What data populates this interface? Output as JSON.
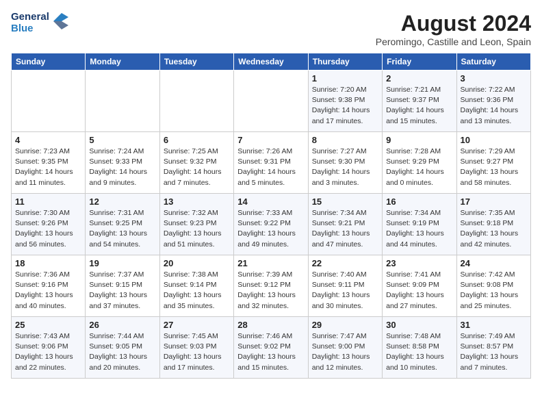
{
  "logo": {
    "line1": "General",
    "line2": "Blue"
  },
  "title": "August 2024",
  "location": "Peromingo, Castille and Leon, Spain",
  "weekdays": [
    "Sunday",
    "Monday",
    "Tuesday",
    "Wednesday",
    "Thursday",
    "Friday",
    "Saturday"
  ],
  "weeks": [
    [
      {
        "day": "",
        "info": ""
      },
      {
        "day": "",
        "info": ""
      },
      {
        "day": "",
        "info": ""
      },
      {
        "day": "",
        "info": ""
      },
      {
        "day": "1",
        "info": "Sunrise: 7:20 AM\nSunset: 9:38 PM\nDaylight: 14 hours and 17 minutes."
      },
      {
        "day": "2",
        "info": "Sunrise: 7:21 AM\nSunset: 9:37 PM\nDaylight: 14 hours and 15 minutes."
      },
      {
        "day": "3",
        "info": "Sunrise: 7:22 AM\nSunset: 9:36 PM\nDaylight: 14 hours and 13 minutes."
      }
    ],
    [
      {
        "day": "4",
        "info": "Sunrise: 7:23 AM\nSunset: 9:35 PM\nDaylight: 14 hours and 11 minutes."
      },
      {
        "day": "5",
        "info": "Sunrise: 7:24 AM\nSunset: 9:33 PM\nDaylight: 14 hours and 9 minutes."
      },
      {
        "day": "6",
        "info": "Sunrise: 7:25 AM\nSunset: 9:32 PM\nDaylight: 14 hours and 7 minutes."
      },
      {
        "day": "7",
        "info": "Sunrise: 7:26 AM\nSunset: 9:31 PM\nDaylight: 14 hours and 5 minutes."
      },
      {
        "day": "8",
        "info": "Sunrise: 7:27 AM\nSunset: 9:30 PM\nDaylight: 14 hours and 3 minutes."
      },
      {
        "day": "9",
        "info": "Sunrise: 7:28 AM\nSunset: 9:29 PM\nDaylight: 14 hours and 0 minutes."
      },
      {
        "day": "10",
        "info": "Sunrise: 7:29 AM\nSunset: 9:27 PM\nDaylight: 13 hours and 58 minutes."
      }
    ],
    [
      {
        "day": "11",
        "info": "Sunrise: 7:30 AM\nSunset: 9:26 PM\nDaylight: 13 hours and 56 minutes."
      },
      {
        "day": "12",
        "info": "Sunrise: 7:31 AM\nSunset: 9:25 PM\nDaylight: 13 hours and 54 minutes."
      },
      {
        "day": "13",
        "info": "Sunrise: 7:32 AM\nSunset: 9:23 PM\nDaylight: 13 hours and 51 minutes."
      },
      {
        "day": "14",
        "info": "Sunrise: 7:33 AM\nSunset: 9:22 PM\nDaylight: 13 hours and 49 minutes."
      },
      {
        "day": "15",
        "info": "Sunrise: 7:34 AM\nSunset: 9:21 PM\nDaylight: 13 hours and 47 minutes."
      },
      {
        "day": "16",
        "info": "Sunrise: 7:34 AM\nSunset: 9:19 PM\nDaylight: 13 hours and 44 minutes."
      },
      {
        "day": "17",
        "info": "Sunrise: 7:35 AM\nSunset: 9:18 PM\nDaylight: 13 hours and 42 minutes."
      }
    ],
    [
      {
        "day": "18",
        "info": "Sunrise: 7:36 AM\nSunset: 9:16 PM\nDaylight: 13 hours and 40 minutes."
      },
      {
        "day": "19",
        "info": "Sunrise: 7:37 AM\nSunset: 9:15 PM\nDaylight: 13 hours and 37 minutes."
      },
      {
        "day": "20",
        "info": "Sunrise: 7:38 AM\nSunset: 9:14 PM\nDaylight: 13 hours and 35 minutes."
      },
      {
        "day": "21",
        "info": "Sunrise: 7:39 AM\nSunset: 9:12 PM\nDaylight: 13 hours and 32 minutes."
      },
      {
        "day": "22",
        "info": "Sunrise: 7:40 AM\nSunset: 9:11 PM\nDaylight: 13 hours and 30 minutes."
      },
      {
        "day": "23",
        "info": "Sunrise: 7:41 AM\nSunset: 9:09 PM\nDaylight: 13 hours and 27 minutes."
      },
      {
        "day": "24",
        "info": "Sunrise: 7:42 AM\nSunset: 9:08 PM\nDaylight: 13 hours and 25 minutes."
      }
    ],
    [
      {
        "day": "25",
        "info": "Sunrise: 7:43 AM\nSunset: 9:06 PM\nDaylight: 13 hours and 22 minutes."
      },
      {
        "day": "26",
        "info": "Sunrise: 7:44 AM\nSunset: 9:05 PM\nDaylight: 13 hours and 20 minutes."
      },
      {
        "day": "27",
        "info": "Sunrise: 7:45 AM\nSunset: 9:03 PM\nDaylight: 13 hours and 17 minutes."
      },
      {
        "day": "28",
        "info": "Sunrise: 7:46 AM\nSunset: 9:02 PM\nDaylight: 13 hours and 15 minutes."
      },
      {
        "day": "29",
        "info": "Sunrise: 7:47 AM\nSunset: 9:00 PM\nDaylight: 13 hours and 12 minutes."
      },
      {
        "day": "30",
        "info": "Sunrise: 7:48 AM\nSunset: 8:58 PM\nDaylight: 13 hours and 10 minutes."
      },
      {
        "day": "31",
        "info": "Sunrise: 7:49 AM\nSunset: 8:57 PM\nDaylight: 13 hours and 7 minutes."
      }
    ]
  ]
}
